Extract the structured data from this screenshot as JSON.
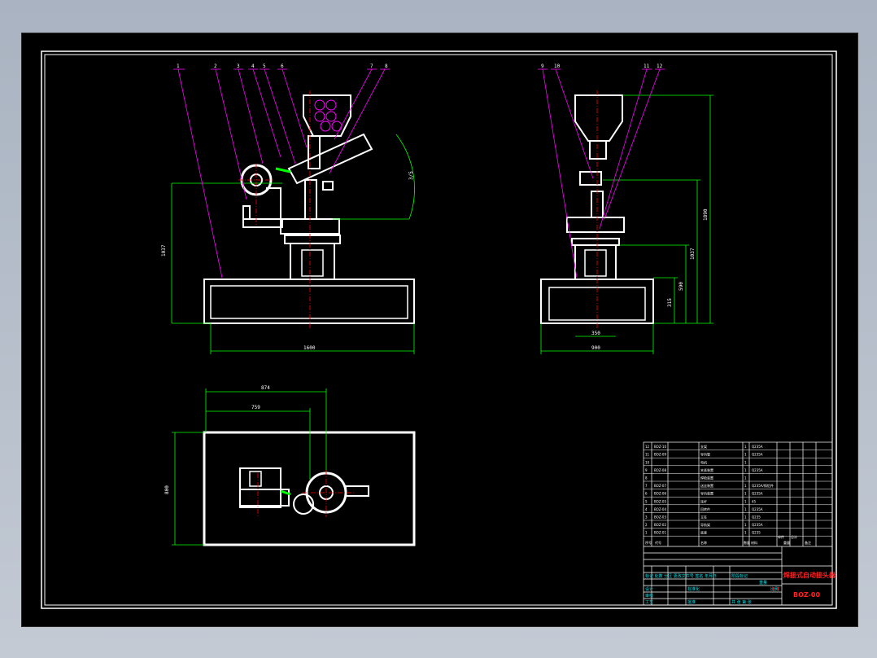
{
  "drawing": {
    "front_view": {
      "balloons": [
        "1",
        "2",
        "3",
        "4",
        "5",
        "6",
        "7",
        "8"
      ],
      "dims": {
        "width": "1600",
        "height": "1037",
        "angle": "3/5"
      }
    },
    "side_view": {
      "balloons": [
        "9",
        "10",
        "11",
        "12"
      ],
      "dims": {
        "total_height": "1890",
        "h2": "1037",
        "h3": "590",
        "h4": "315",
        "inner_width": "350",
        "width": "900"
      }
    },
    "top_view": {
      "dims": {
        "d1": "874",
        "d2": "759",
        "height": "800"
      }
    },
    "title_block": {
      "title": "焊接式自动接头器",
      "drawing_no": "BOZ-00",
      "scale": "1:1",
      "bom_header": {
        "seq": "序号",
        "code": "代号",
        "name": "名称",
        "qty": "数量",
        "material": "材料",
        "unit_w": "单件",
        "total_w": "总计",
        "weight": "重量",
        "remark": "备注"
      },
      "bom": [
        {
          "seq": "12",
          "code": "BOZ-10",
          "name": "支架",
          "qty": "1",
          "material": "Q235A"
        },
        {
          "seq": "11",
          "code": "BOZ-09",
          "name": "导向管",
          "qty": "1",
          "material": "Q235A"
        },
        {
          "seq": "10",
          "code": "",
          "name": "电机",
          "qty": "1",
          "material": ""
        },
        {
          "seq": "9",
          "code": "BOZ-08",
          "name": "夹紧装置",
          "qty": "1",
          "material": "Q235A"
        },
        {
          "seq": "8",
          "code": "",
          "name": "焊枪装置",
          "qty": "1",
          "material": ""
        },
        {
          "seq": "7",
          "code": "BOZ-07",
          "name": "送丝装置",
          "qty": "1",
          "material": "Q235A/铸铝件"
        },
        {
          "seq": "6",
          "code": "BOZ-06",
          "name": "导向装置",
          "qty": "1",
          "material": "Q235A"
        },
        {
          "seq": "5",
          "code": "BOZ-05",
          "name": "连杆",
          "qty": "1",
          "material": "45"
        },
        {
          "seq": "4",
          "code": "BOZ-04",
          "name": "回转件",
          "qty": "1",
          "material": "Q235A"
        },
        {
          "seq": "3",
          "code": "BOZ-03",
          "name": "立柱",
          "qty": "1",
          "material": "Q235"
        },
        {
          "seq": "2",
          "code": "BOZ-02",
          "name": "导轨架",
          "qty": "1",
          "material": "Q235A"
        },
        {
          "seq": "1",
          "code": "BOZ-01",
          "name": "底座",
          "qty": "1",
          "material": "Q235"
        }
      ],
      "rev_row": "标记 处数 分区 更改文件号 签名 年月日",
      "sign": [
        "设计",
        "审核",
        "工艺"
      ],
      "std": "标准化",
      "approve": "批准",
      "stage": "阶段标记",
      "weight": "重量",
      "ratio": "比例",
      "sheet": "共 张 第 张"
    }
  },
  "colors": {
    "background": "#000000",
    "outline": "#ffffff",
    "dimension": "#00ff00",
    "leader": "#ff00ff",
    "centerline": "#ff0000",
    "caption": "#00e5ee"
  }
}
